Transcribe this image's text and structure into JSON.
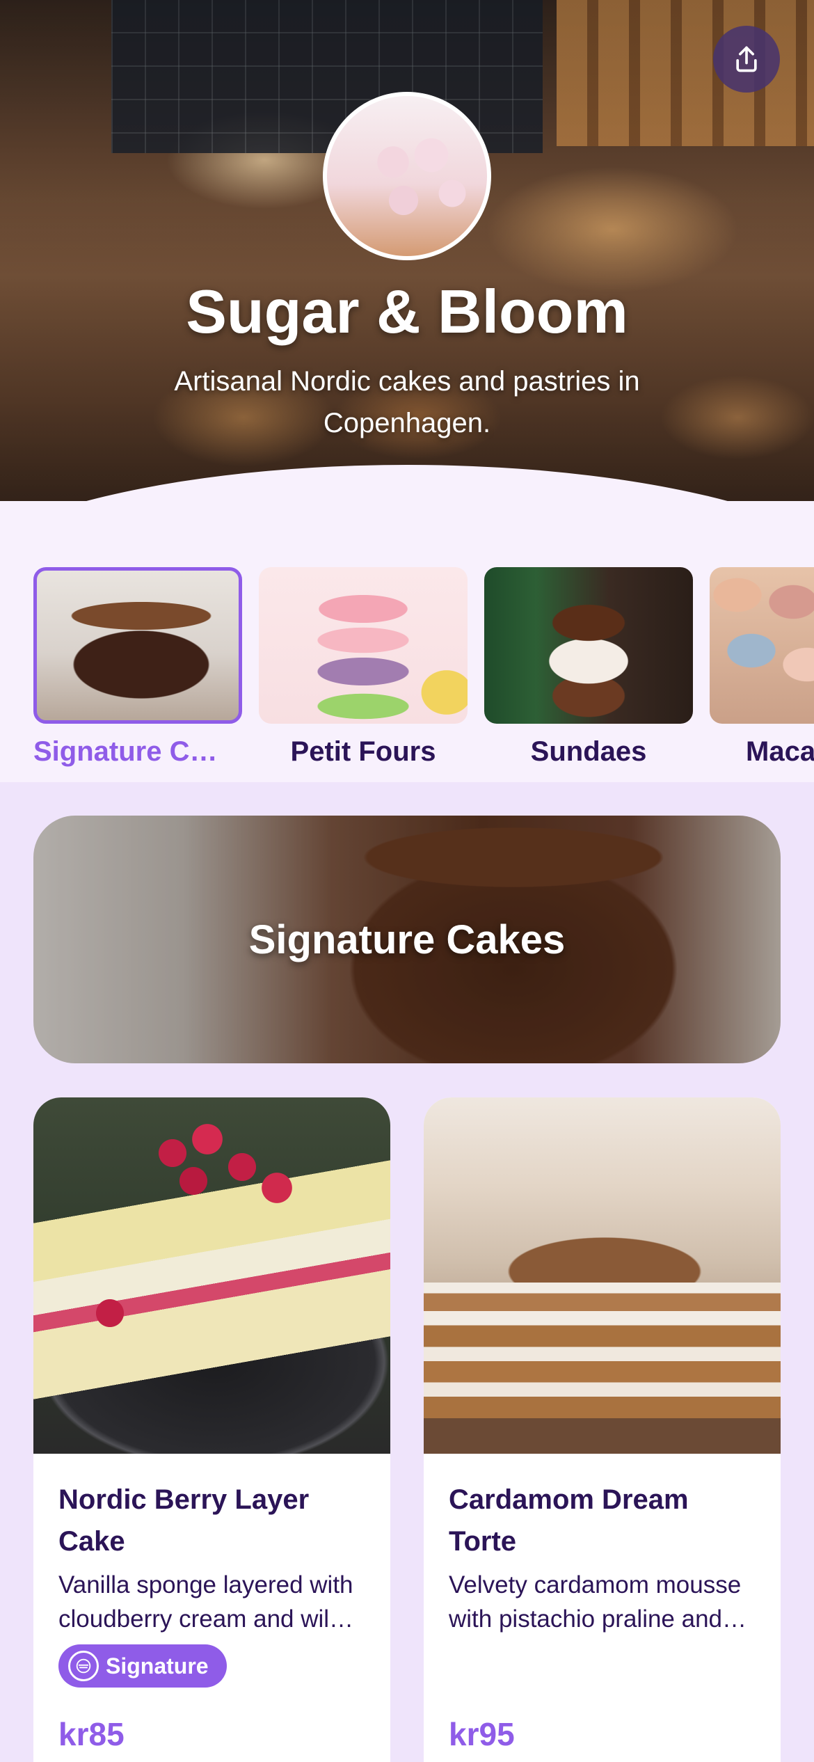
{
  "store": {
    "name": "Sugar & Bloom",
    "tagline": "Artisanal Nordic cakes and pastries in Copenhagen."
  },
  "header": {
    "share_icon": "share-upload-icon"
  },
  "categories": [
    {
      "label": "Signature C…",
      "active": true
    },
    {
      "label": "Petit Fours",
      "active": false
    },
    {
      "label": "Sundaes",
      "active": false
    },
    {
      "label": "Maca",
      "active": false
    }
  ],
  "section": {
    "title": "Signature Cakes"
  },
  "products": [
    {
      "name": "Nordic Berry Layer Cake",
      "description": "Vanilla sponge layered with cloudberry cream and wil…",
      "badge": "Signature",
      "price": "kr85"
    },
    {
      "name": "Cardamom Dream Torte",
      "description": "Velvety cardamom mousse with pistachio praline and…",
      "badge": "",
      "price": "kr95"
    }
  ],
  "colors": {
    "accent": "#8f5ce8",
    "text_primary": "#2b1457",
    "page_background": "#efe4fb",
    "strip_background": "#f8f1fd"
  }
}
